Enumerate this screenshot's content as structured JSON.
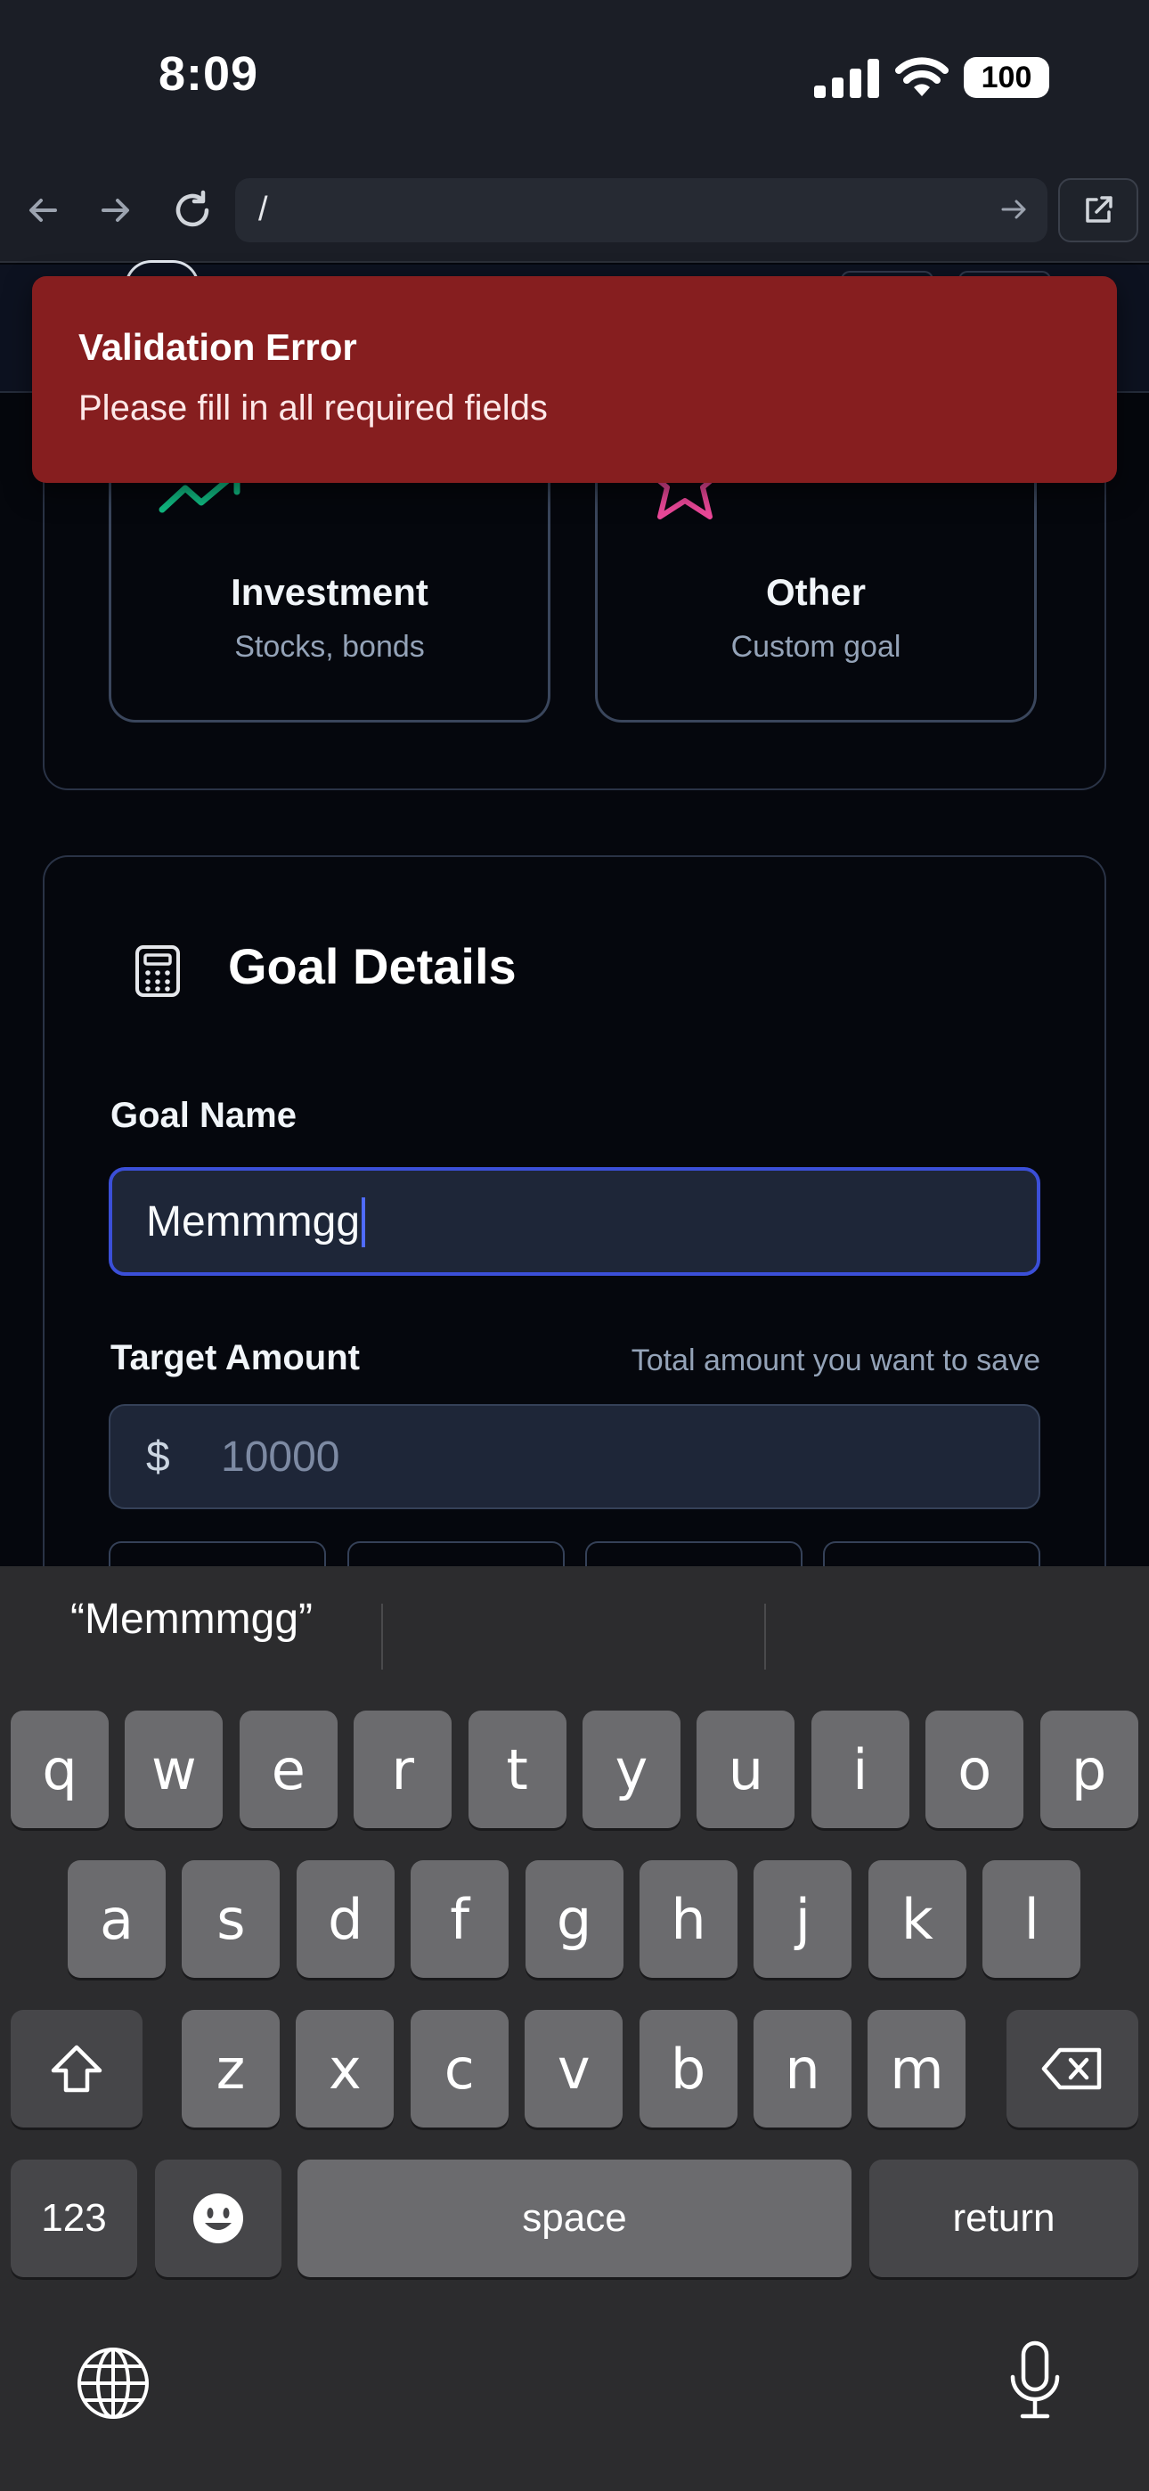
{
  "status_bar": {
    "time": "8:09",
    "battery": "100"
  },
  "browser": {
    "url": "/"
  },
  "goal_types": [
    {
      "title": "Investment",
      "subtitle": "Stocks, bonds"
    },
    {
      "title": "Other",
      "subtitle": "Custom goal"
    }
  ],
  "goal_details": {
    "title": "Goal Details",
    "goal_name_label": "Goal Name",
    "goal_name_value": "Memmmgg",
    "target_label": "Target Amount",
    "target_hint": "Total amount you want to save",
    "currency": "$",
    "target_placeholder": "10000"
  },
  "toast": {
    "title": "Validation Error",
    "message": "Please fill in all required fields",
    "color": "#861e1f"
  },
  "keyboard": {
    "suggestion": "“Memmmgg”",
    "row1": [
      "q",
      "w",
      "e",
      "r",
      "t",
      "y",
      "u",
      "i",
      "o",
      "p"
    ],
    "row2": [
      "a",
      "s",
      "d",
      "f",
      "g",
      "h",
      "j",
      "k",
      "l"
    ],
    "row3": [
      "z",
      "x",
      "c",
      "v",
      "b",
      "n",
      "m"
    ],
    "numbers_label": "123",
    "space_label": "space",
    "return_label": "return"
  },
  "colors": {
    "accent": "#3b4fd8",
    "investment_icon": "#10b981",
    "other_icon": "#ec4899"
  }
}
